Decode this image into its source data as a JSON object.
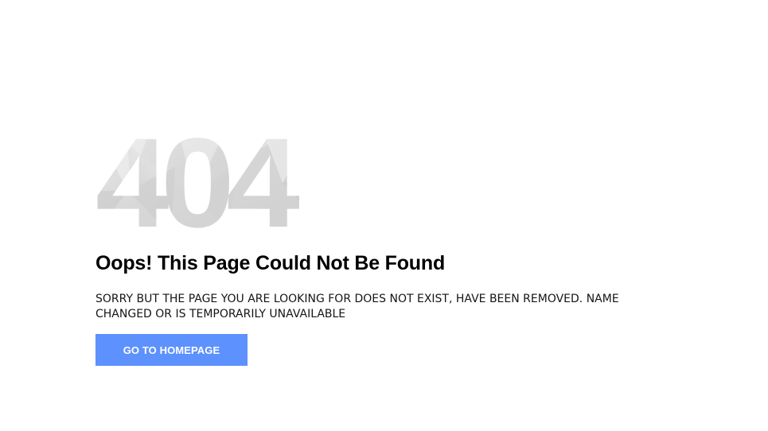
{
  "error_page": {
    "code": "404",
    "heading": "Oops! This Page Could Not Be Found",
    "message": "SORRY BUT THE PAGE YOU ARE LOOKING FOR DOES NOT EXIST, HAVE BEEN REMOVED. NAME CHANGED OR IS TEMPORARILY UNAVAILABLE",
    "button_label": "GO TO HOMEPAGE"
  },
  "colors": {
    "background": "#ffffff",
    "code_base": "#d8d8d8",
    "button_background": "#5c91fe",
    "button_text": "#ffffff",
    "heading_text": "#000000"
  }
}
